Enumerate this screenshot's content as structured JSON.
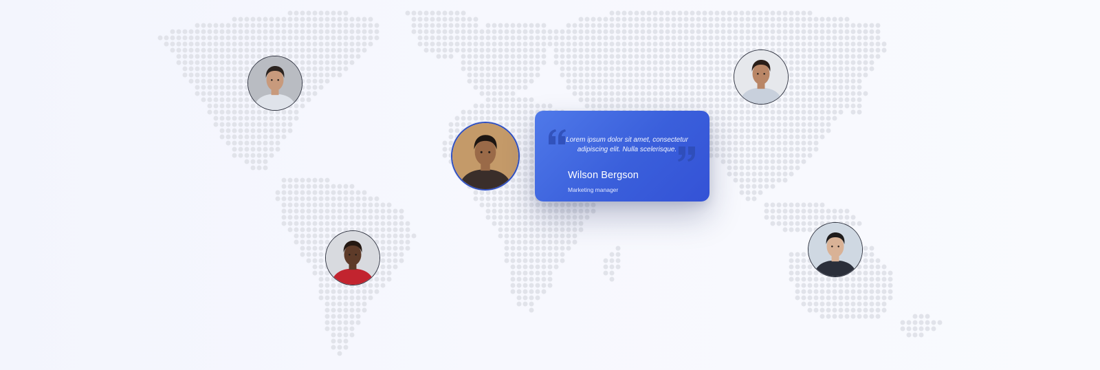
{
  "testimonial": {
    "quote": "Lorem ipsum dolor sit amet, consectetur adipiscing elit. Nulla scelerisque.",
    "name": "Wilson Bergson",
    "role": "Marketing manager"
  },
  "avatars": [
    {
      "id": "north-america",
      "active": false,
      "bg": "#b9bcc2",
      "skin": "#c89a7c",
      "hair": "#2c2420",
      "shirt": "#dfe3ea"
    },
    {
      "id": "south-america",
      "active": false,
      "bg": "#d8dadf",
      "skin": "#5e3b29",
      "hair": "#241812",
      "shirt": "#c2242f"
    },
    {
      "id": "africa-featured",
      "active": true,
      "bg": "#c49a69",
      "skin": "#9a6a48",
      "hair": "#1d1612",
      "shirt": "#3a2e2a"
    },
    {
      "id": "asia",
      "active": false,
      "bg": "#e6e8ec",
      "skin": "#b98666",
      "hair": "#2a1e18",
      "shirt": "#c8d0dc"
    },
    {
      "id": "australia",
      "active": false,
      "bg": "#cfd8e2",
      "skin": "#d9b296",
      "hair": "#1f1c1c",
      "shirt": "#2b2f3a"
    }
  ],
  "colors": {
    "map_dot": "#e1e3ea",
    "card_start": "#4f79e9",
    "card_end": "#3452d6",
    "quote_mark": "#2e4cb5"
  }
}
